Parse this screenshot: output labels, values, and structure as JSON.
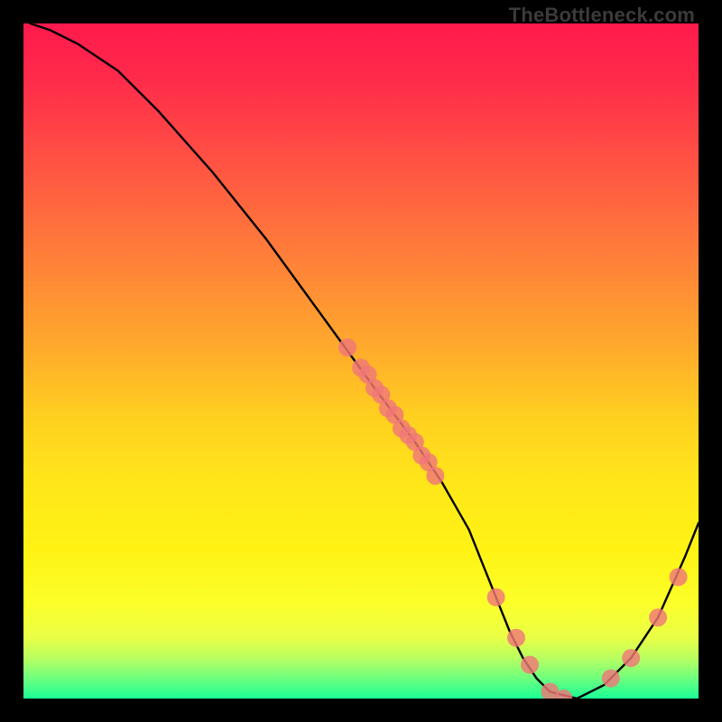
{
  "attribution": "TheBottleneck.com",
  "chart_data": {
    "type": "line",
    "title": "",
    "xlabel": "",
    "ylabel": "",
    "xlim": [
      0,
      100
    ],
    "ylim": [
      0,
      100
    ],
    "series": [
      {
        "name": "bottleneck-curve",
        "x": [
          1,
          4,
          8,
          14,
          20,
          28,
          36,
          44,
          52,
          58,
          62,
          66,
          68,
          70,
          72,
          74,
          76,
          78,
          82,
          86,
          90,
          94,
          98,
          100
        ],
        "y": [
          100,
          99,
          97,
          93,
          87,
          78,
          68,
          57,
          46,
          38,
          32,
          25,
          20,
          15,
          10,
          6,
          3,
          1,
          0,
          2,
          6,
          12,
          21,
          26
        ]
      }
    ],
    "markers": {
      "name": "highlight-dots",
      "x": [
        48,
        50,
        51,
        52,
        53,
        54,
        55,
        56,
        57,
        58,
        59,
        60,
        61,
        70,
        73,
        75,
        78,
        80,
        87,
        90,
        94,
        97
      ],
      "y": [
        52,
        49,
        48,
        46,
        45,
        43,
        42,
        40,
        39,
        38,
        36,
        35,
        33,
        15,
        9,
        5,
        1,
        0,
        3,
        6,
        12,
        18
      ]
    },
    "background": {
      "type": "vertical-gradient",
      "stops": [
        {
          "pos": 0.0,
          "color": "#ff1a4d"
        },
        {
          "pos": 0.5,
          "color": "#ffcf20"
        },
        {
          "pos": 0.85,
          "color": "#fcff2a"
        },
        {
          "pos": 1.0,
          "color": "#1aff96"
        }
      ]
    }
  }
}
